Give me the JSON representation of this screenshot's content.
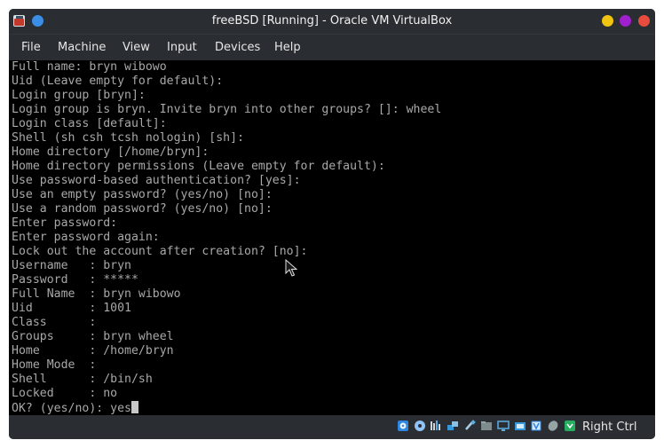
{
  "window": {
    "title": "freeBSD [Running] - Oracle VM VirtualBox",
    "colors": {
      "frame": "#2a2e32",
      "console_bg": "#000000",
      "console_text": "#a8a8a8",
      "minimize": "#f1c40f",
      "maximize": "#a020d0",
      "close": "#e74c3c"
    }
  },
  "menu": {
    "items": [
      "File",
      "Machine",
      "View",
      "Input",
      "Devices",
      "Help"
    ]
  },
  "console": {
    "lines": [
      "Full name: bryn wibowo",
      "Uid (Leave empty for default):",
      "Login group [bryn]:",
      "Login group is bryn. Invite bryn into other groups? []: wheel",
      "Login class [default]:",
      "Shell (sh csh tcsh nologin) [sh]:",
      "Home directory [/home/bryn]:",
      "Home directory permissions (Leave empty for default):",
      "Use password-based authentication? [yes]:",
      "Use an empty password? (yes/no) [no]:",
      "Use a random password? (yes/no) [no]:",
      "Enter password:",
      "Enter password again:",
      "Lock out the account after creation? [no]:",
      "Username   : bryn",
      "Password   : *****",
      "Full Name  : bryn wibowo",
      "Uid        : 1001",
      "Class      :",
      "Groups     : bryn wheel",
      "Home       : /home/bryn",
      "Home Mode  :",
      "Shell      : /bin/sh",
      "Locked     : no"
    ],
    "prompt": "OK? (yes/no): ",
    "input_value": "yes"
  },
  "statusbar": {
    "icons": [
      "hard-disk-icon",
      "optical-drive-icon",
      "audio-icon",
      "network-icon",
      "usb-icon",
      "shared-folders-icon",
      "display-icon",
      "video-capture-icon",
      "cpu-icon",
      "mouse-integration-icon",
      "keyboard-capture-icon"
    ],
    "host_key": "Right Ctrl"
  }
}
